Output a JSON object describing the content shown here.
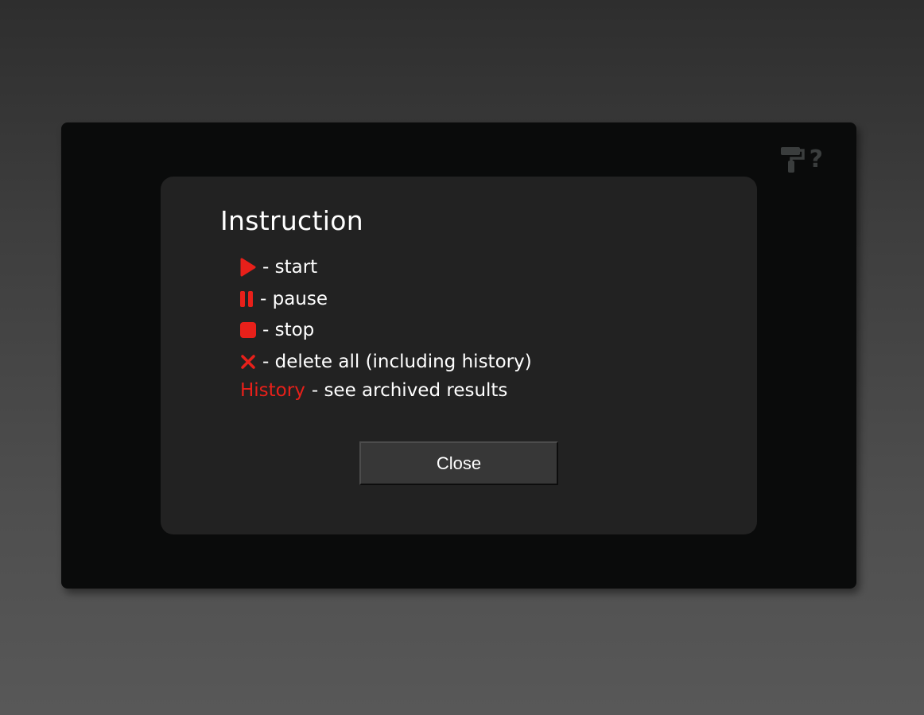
{
  "colors": {
    "accent": "#e8201a",
    "modal_bg": "#222222",
    "window_bg": "#0a0b0b",
    "toolbar_icon": "#3a3d3d"
  },
  "toolbar": {
    "icons": [
      "paint-roller-icon",
      "help-icon"
    ],
    "help_label": "?"
  },
  "modal": {
    "title": "Instruction",
    "items": [
      {
        "icon": "play-icon",
        "text": "- start"
      },
      {
        "icon": "pause-icon",
        "text": "- pause"
      },
      {
        "icon": "stop-icon",
        "text": "- stop"
      },
      {
        "icon": "close-x-icon",
        "text": "- delete all (including history)"
      },
      {
        "keyword": "History",
        "text": "- see archived results"
      }
    ],
    "close_label": "Close"
  }
}
